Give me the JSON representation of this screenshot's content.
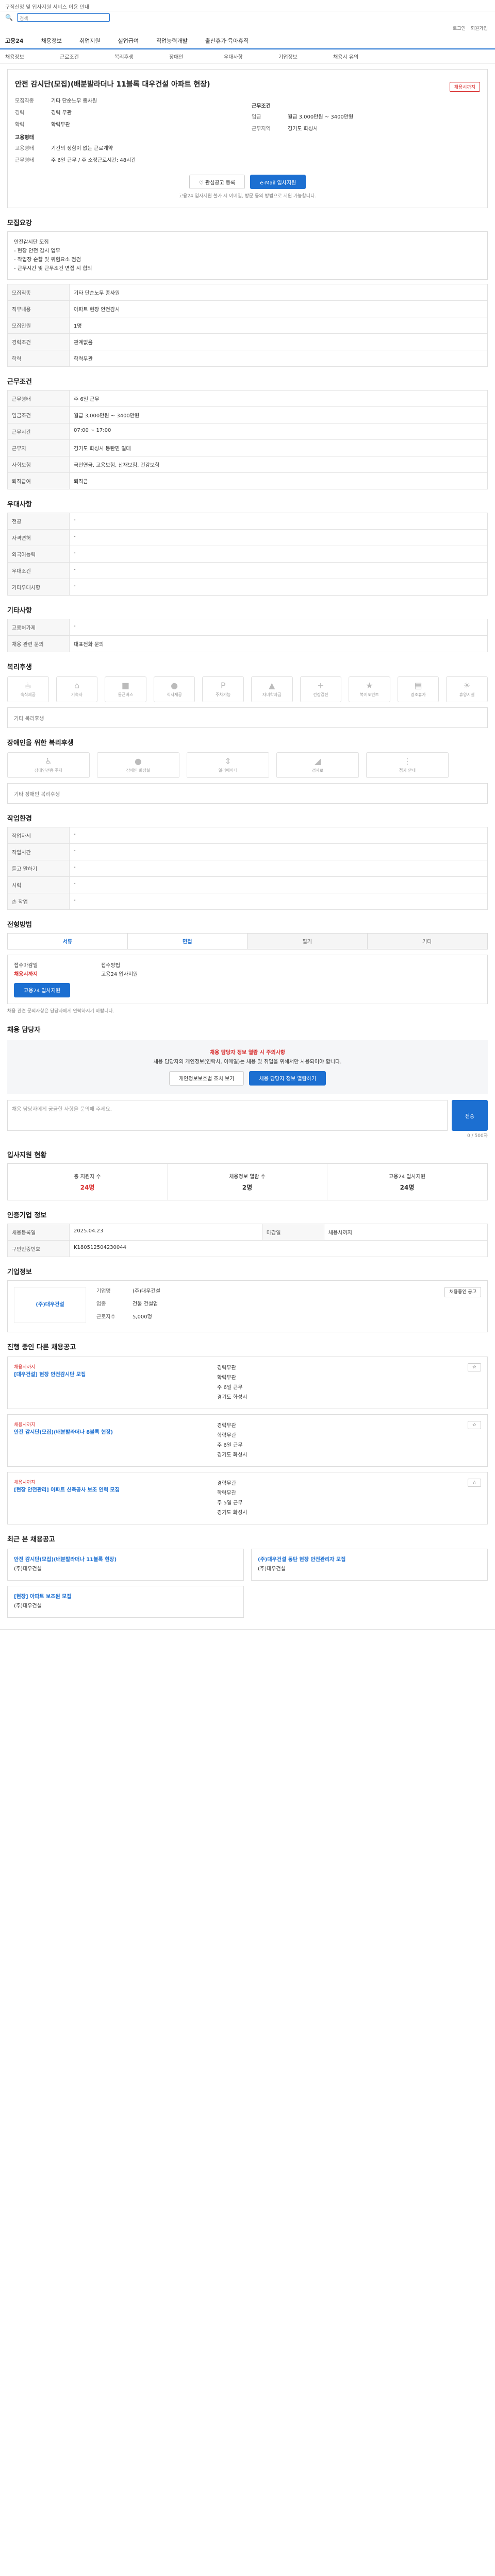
{
  "notice": "구직신청 및 입사지원 서비스 이용 안내",
  "search": {
    "placeholder": "검색"
  },
  "util": [
    "로그인",
    "회원가입"
  ],
  "gnb": {
    "logo": "고용24",
    "menu": [
      "채용정보",
      "취업지원",
      "실업급여",
      "직업능력개발",
      "출산휴가·육아휴직"
    ]
  },
  "crumbs": [
    "채용정보",
    "근로조건",
    "복리후생",
    "장애인",
    "우대사항",
    "기업정보",
    "채용시 유의"
  ],
  "job": {
    "title": "안전 감시단(모집)(배분발라더나 11블록 대우건설 아파트 현장)",
    "status": "채용시까지",
    "left_rows": [
      {
        "k": "모집직종",
        "v": "기타 단순노무 종사원"
      },
      {
        "k": "경력",
        "v": "경력 무관"
      },
      {
        "k": "학력",
        "v": "학력무관"
      }
    ],
    "cond_head": "고용형태",
    "cond_rows": [
      {
        "k": "고용형태",
        "v": "기간의 정함이 없는 근로계약"
      },
      {
        "k": "근무형태",
        "v": "주 6일 근무 / 주 소정근로시간: 48시간"
      }
    ],
    "right_head": "근무조건",
    "right_rows": [
      {
        "k": "임금",
        "v": "월급 3,000만원 ~ 3400만원"
      },
      {
        "k": "근무지역",
        "v": "경기도 화성시"
      }
    ],
    "btn_scrap": "관심공고 등록",
    "btn_apply": "e-Mail 입사지원",
    "note": "고용24 입사지원 불가 시 이메일, 방문 등의 방법으로 지원 가능합니다."
  },
  "sec_recruit": {
    "title": "모집요강",
    "lines": [
      "안전감시단 모집",
      "- 현장 안전 감시 업무",
      "- 작업장 순찰 및 위험요소 점검",
      "- 근무시간 및 근무조건 면접 시 협의"
    ]
  },
  "recruit_rows": [
    {
      "k": "모집직종",
      "v": "기타 단순노무 종사원"
    },
    {
      "k": "직무내용",
      "v": "아파트 현장 안전감시"
    },
    {
      "k": "모집인원",
      "v": "1명"
    },
    {
      "k": "경력조건",
      "v": "관계없음"
    },
    {
      "k": "학력",
      "v": "학력무관"
    }
  ],
  "sec_cond": {
    "title": "근무조건"
  },
  "cond_rows": [
    {
      "k": "근무형태",
      "v": "주 6일 근무"
    },
    {
      "k": "임금조건",
      "v": "월급 3,000만원 ~ 3400만원"
    },
    {
      "k": "근무시간",
      "v": "07:00 ~ 17:00"
    },
    {
      "k": "근무지",
      "v": "경기도 화성시 동탄면 일대"
    },
    {
      "k": "사회보험",
      "v": "국민연금, 고용보험, 산재보험, 건강보험"
    },
    {
      "k": "퇴직급여",
      "v": "퇴직금"
    }
  ],
  "sec_pref": {
    "title": "우대사항"
  },
  "pref_rows": [
    {
      "k": "전공",
      "v": "-"
    },
    {
      "k": "자격면허",
      "v": "-"
    },
    {
      "k": "외국어능력",
      "v": "-"
    },
    {
      "k": "우대조건",
      "v": "-"
    },
    {
      "k": "기타우대사항",
      "v": "-"
    }
  ],
  "sec_etc": {
    "title": "기타사항"
  },
  "etc_rows": [
    {
      "k": "고용허가제",
      "v": "-"
    },
    {
      "k": "채용 관련 문의",
      "v": "대표전화 문의"
    }
  ],
  "sec_welfare": {
    "title": "복리후생",
    "empty": "기타 복리후생"
  },
  "welfare_icons": [
    "숙식제공",
    "기숙사",
    "통근버스",
    "식사제공",
    "주차가능",
    "자녀학자금",
    "건강검진",
    "복지포인트",
    "경조휴가",
    "휴양시설"
  ],
  "sec_disab": {
    "title": "장애인을 위한 복리후생",
    "empty": "기타 장애인 복리후생"
  },
  "disab_icons": [
    "장애인전용 주차",
    "장애인 화장실",
    "엘리베이터",
    "경사로",
    "점자 안내"
  ],
  "sec_work": {
    "title": "작업환경"
  },
  "work_rows": [
    {
      "k": "작업자세",
      "v": "-"
    },
    {
      "k": "작업시간",
      "v": "-"
    },
    {
      "k": "듣고 말하기",
      "v": "-"
    },
    {
      "k": "시력",
      "v": "-"
    },
    {
      "k": "손 작업",
      "v": "-"
    }
  ],
  "sec_method": {
    "title": "전형방법"
  },
  "method_tabs": [
    "서류",
    "면접",
    "필기",
    "기타"
  ],
  "apply_rows": [
    {
      "k": "접수마감일",
      "v": "채용시까지"
    },
    {
      "k": "접수방법",
      "v": "고용24 입사지원"
    }
  ],
  "apply_btn": "고용24 입사지원",
  "apply_note": "채용 관련 문의사항은 담당자에게 연락하시기 바랍니다.",
  "sec_contact": {
    "title": "채용 담당자",
    "warn": "채용 담당자 정보 열람 시 주의사항",
    "desc": "채용 담당자의 개인정보(연락처, 이메일)는 채용 및 취업을 위해서만 사용되어야 합니다.",
    "btn1": "개인정보보호법 조치 보기",
    "btn2": "채용 담당자 정보 열람하기",
    "qa_placeholder": "채용 담당자에게 궁금한 사항을 문의해 주세요.",
    "qa_btn": "전송",
    "count": "0 / 500자"
  },
  "sec_stat": {
    "title": "입사지원 현황",
    "items": [
      {
        "k": "총 지원자 수",
        "v": "24명"
      },
      {
        "k": "채용정보 열람 수",
        "v": "2명"
      },
      {
        "k": "고용24 입사지원",
        "v": "24명"
      }
    ]
  },
  "sec_info": {
    "title": "인증기업 정보"
  },
  "info_rows": [
    {
      "k": "채용등록일",
      "v": "2025.04.23"
    },
    {
      "k": "마감일",
      "v": "채용시까지"
    },
    {
      "k": "구인인증번호",
      "v": "K180512504230044"
    }
  ],
  "sec_company": {
    "title": "기업정보",
    "name": "(주)대우건설",
    "rows": [
      {
        "k": "기업명",
        "v": "(주)대우건설"
      },
      {
        "k": "업종",
        "v": "건물 건설업"
      },
      {
        "k": "근로자수",
        "v": "5,000명"
      }
    ],
    "btn": "채용중인 공고"
  },
  "sec_similar": {
    "title": "진행 중인 다른 채용공고",
    "items": [
      {
        "tag": "채용시까지",
        "t": "[대우건설] 현장 안전감시단 모집",
        "m": [
          "경력무관",
          "학력무관",
          "주 6일 근무",
          "경기도 화성시"
        ]
      },
      {
        "tag": "채용시까지",
        "t": "안전 감시단(모집)(배분발라더나 8블록 현장)",
        "m": [
          "경력무관",
          "학력무관",
          "주 6일 근무",
          "경기도 화성시"
        ]
      },
      {
        "tag": "채용시까지",
        "t": "[현장 안전관리] 아파트 신축공사 보조 인력 모집",
        "m": [
          "경력무관",
          "학력무관",
          "주 5일 근무",
          "경기도 화성시"
        ]
      }
    ]
  },
  "sec_recent": {
    "title": "최근 본 채용공고",
    "items": [
      {
        "t": "안전 감시단(모집)(배분발라더나 11블록 현장)",
        "s": "(주)대우건설"
      },
      {
        "t": "(주)대우건설 동탄 현장 안전관리자 모집",
        "s": "(주)대우건설"
      }
    ]
  },
  "recent_extra": {
    "t": "[현장] 아파트 보조원 모집",
    "s": "(주)대우건설"
  }
}
